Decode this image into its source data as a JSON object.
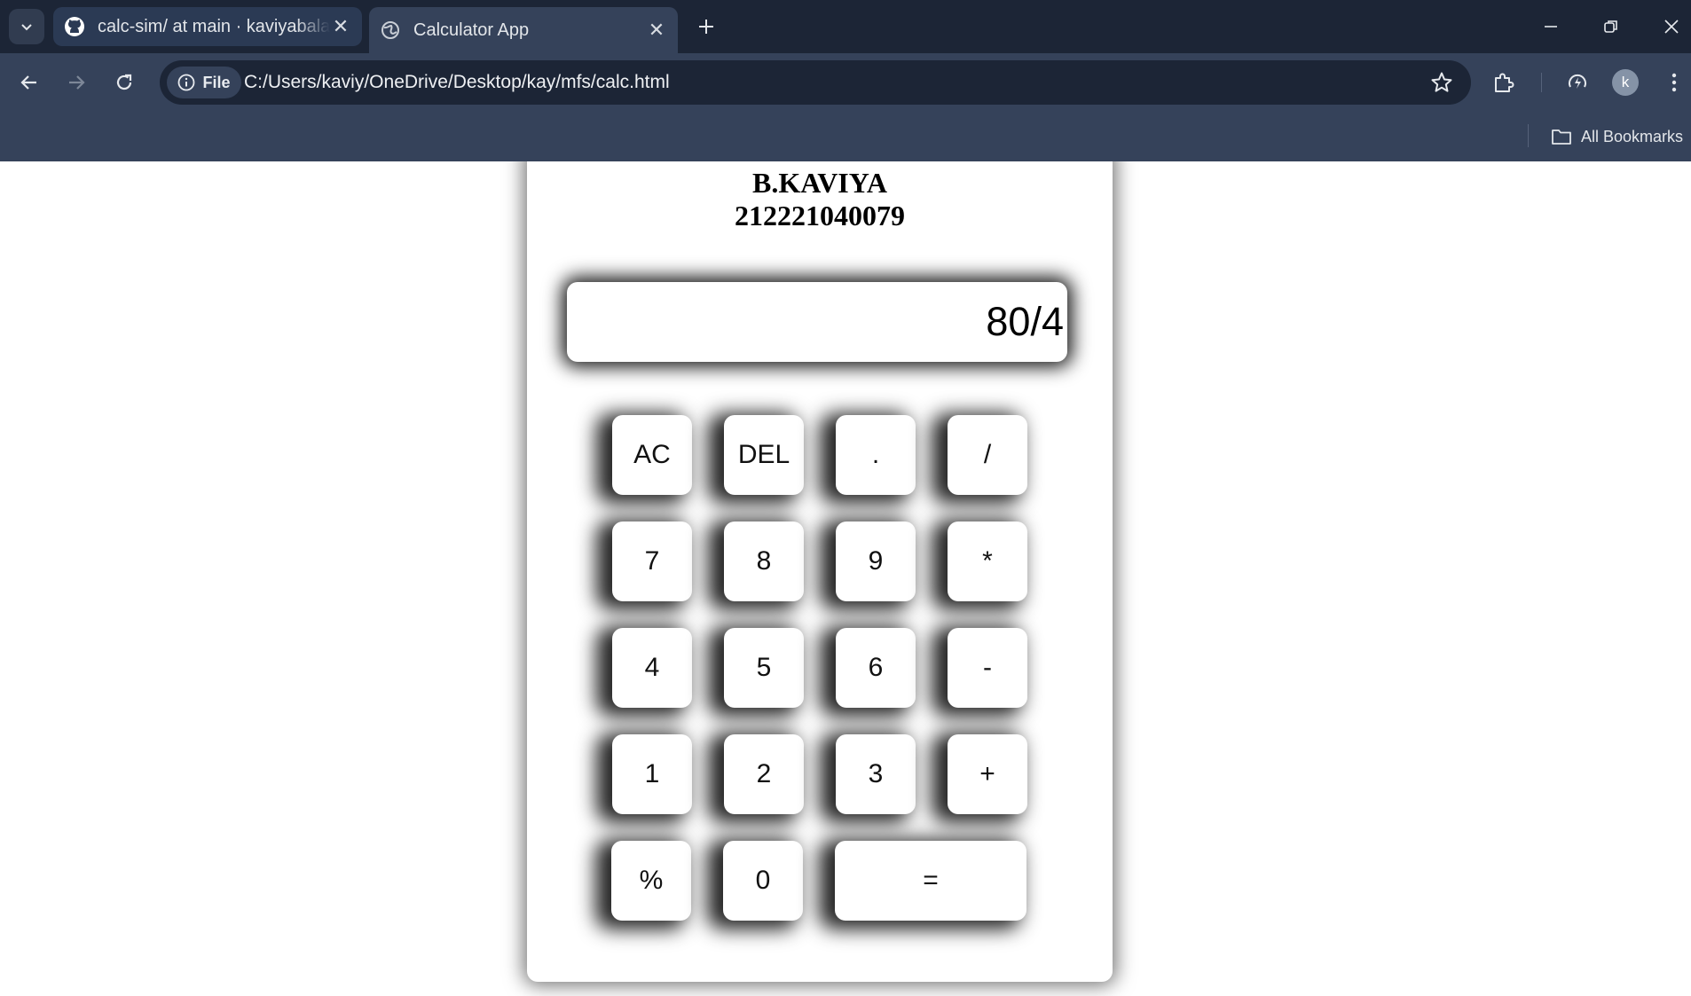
{
  "browser": {
    "tabs": [
      {
        "title": "calc-sim/ at main · kaviyabalaji/calc-sim",
        "favicon": "github-icon",
        "active": false
      },
      {
        "title": "Calculator App",
        "favicon": "globe-icon",
        "active": true
      }
    ],
    "site_chip_label": "File",
    "url": "C:/Users/kaviy/OneDrive/Desktop/kay/mfs/calc.html",
    "avatar_letter": "k",
    "bookmarks_label": "All Bookmarks",
    "colors": {
      "frame": "#1c2536",
      "toolbar": "#35425a"
    }
  },
  "calculator": {
    "name": "B.KAVIYA",
    "reg_no": "212221040079",
    "display_value": "80/4",
    "keys": {
      "ac": "AC",
      "del": "DEL",
      "dot": ".",
      "divide": "/",
      "seven": "7",
      "eight": "8",
      "nine": "9",
      "multiply": "*",
      "four": "4",
      "five": "5",
      "six": "6",
      "minus": "-",
      "one": "1",
      "two": "2",
      "three": "3",
      "plus": "+",
      "percent": "%",
      "zero": "0",
      "equals": "="
    }
  }
}
